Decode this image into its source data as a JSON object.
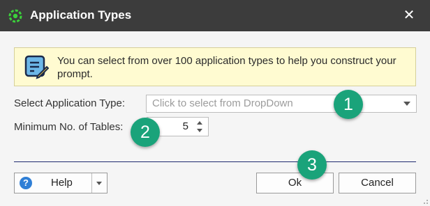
{
  "window": {
    "title": "Application Types",
    "close_glyph": "✕"
  },
  "info": {
    "icon": "note-edit-icon",
    "text": "You can select from over 100 application types to help you construct your prompt."
  },
  "form": {
    "app_type_label": "Select Application Type:",
    "app_type_placeholder": "Click to select from DropDown",
    "min_tables_label": "Minimum No. of Tables:",
    "min_tables_value": "5"
  },
  "buttons": {
    "help": "Help",
    "ok": "Ok",
    "cancel": "Cancel"
  },
  "badges": [
    "1",
    "2",
    "3"
  ],
  "colors": {
    "titlebar": "#3c3c3c",
    "badge": "#1aa37a",
    "info_bg": "#fffbd1",
    "separator": "#1e2a6e"
  }
}
